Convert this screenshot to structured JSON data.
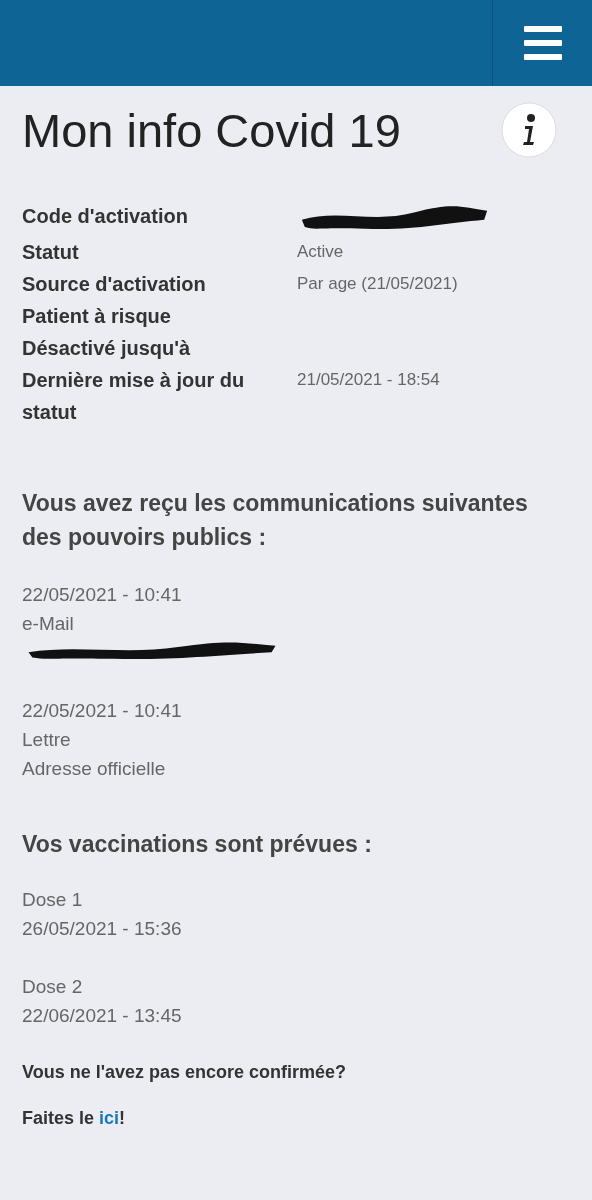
{
  "title": "Mon info Covid 19",
  "fields": [
    {
      "label": "Code d'activation",
      "redacted": true
    },
    {
      "label": "Statut",
      "value": "Active",
      "redacted": false
    },
    {
      "label": "Source d'activation",
      "value": "Par age (21/05/2021)",
      "redacted": false
    },
    {
      "label": "Patient à risque",
      "redacted": false
    },
    {
      "label": "Désactivé jusqu'à",
      "redacted": false
    },
    {
      "label": "Dernière mise à jour du statut",
      "value": "21/05/2021 - 18:54",
      "redacted": false
    }
  ],
  "communications": {
    "heading": "Vous avez reçu les communications suivantes des pouvoirs publics :",
    "items": [
      {
        "date": "22/05/2021 - 10:41",
        "channel": "e-Mail",
        "redacted": true
      },
      {
        "date": "22/05/2021 - 10:41",
        "channel": "Lettre",
        "address": "Adresse officielle",
        "redacted": false
      }
    ]
  },
  "vaccinations": {
    "heading": "Vos vaccinations sont prévues :",
    "doses": [
      {
        "name": "Dose 1",
        "date": "26/05/2021 - 15:36"
      },
      {
        "name": "Dose 2",
        "date": "22/06/2021 - 13:45"
      }
    ]
  },
  "confirm": {
    "question": "Vous ne l'avez pas encore confirmée?",
    "prefix": "Faites le ",
    "link": "ici",
    "suffix": "!"
  }
}
